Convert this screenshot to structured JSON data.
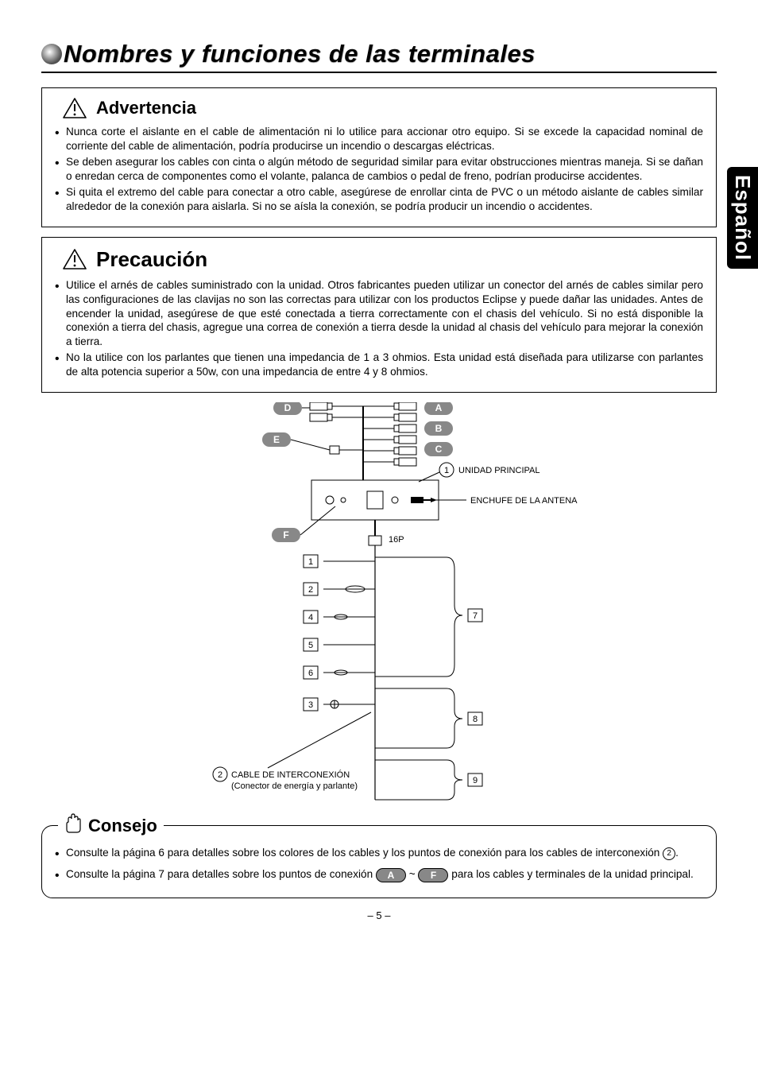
{
  "title": "Nombres y funciones de las terminales",
  "side_tab": "Español",
  "advertencia": {
    "heading": "Advertencia",
    "items": [
      "Nunca corte el aislante en el cable de alimentación ni lo utilice para accionar otro equipo. Si se excede la capacidad nominal de corriente del cable de alimentación, podría producirse un incendio o descargas eléctricas.",
      "Se deben asegurar los cables con cinta o algún método de seguridad similar para evitar obstrucciones mientras maneja. Si se dañan o enredan cerca de componentes como el volante, palanca de cambios o pedal de freno, podrían producirse accidentes.",
      "Si quita el extremo del cable para conectar a otro cable, asegúrese de enrollar cinta de PVC o un método aislante de cables similar alrededor de la conexión para aislarla. Si no se aísla la conexión, se podría producir un incendio o accidentes."
    ]
  },
  "precaucion": {
    "heading": "Precaución",
    "items": [
      "Utilice el arnés de cables suministrado con la unidad. Otros fabricantes pueden utilizar un conector del arnés de cables similar pero las configuraciones de las clavijas no son las correctas para utilizar con los productos Eclipse y puede dañar las unidades. Antes de encender la unidad, asegúrese de que esté conectada a tierra correctamente con el chasis del vehículo. Si no está disponible la conexión a tierra del chasis, agregue una correa de conexión a tierra desde la unidad al chasis del vehículo para mejorar la conexión a tierra.",
      "No la utilice con los parlantes que tienen una impedancia de 1 a 3 ohmios. Esta unidad está diseñada para utilizarse con parlantes de alta potencia superior a 50w, con una impedancia de entre 4 y 8 ohmios."
    ]
  },
  "diagram": {
    "letters": {
      "A": "A",
      "B": "B",
      "C": "C",
      "D": "D",
      "E": "E",
      "F": "F"
    },
    "callout_1": "UNIDAD PRINCIPAL",
    "callout_antenna": "ENCHUFE DE LA ANTENA",
    "connector_16p": "16P",
    "numbers": [
      "1",
      "2",
      "3",
      "4",
      "5",
      "6",
      "7",
      "8",
      "9"
    ],
    "interconnect_num": "2",
    "interconnect_title": "CABLE DE INTERCONEXIÓN",
    "interconnect_sub": "(Conector de energía y parlante)",
    "circle_1": "1",
    "circle_2": "2"
  },
  "consejo": {
    "heading": "Consejo",
    "item1_pre": "Consulte la página 6 para detalles sobre los colores de los cables y los puntos de conexión para los cables de interconexión",
    "item1_post": ".",
    "item2_pre": "Consulte la página 7 para detalles sobre los puntos de conexión",
    "item2_mid": "~",
    "item2_post": "para los cables y terminales de la unidad principal."
  },
  "page_number": "– 5 –"
}
